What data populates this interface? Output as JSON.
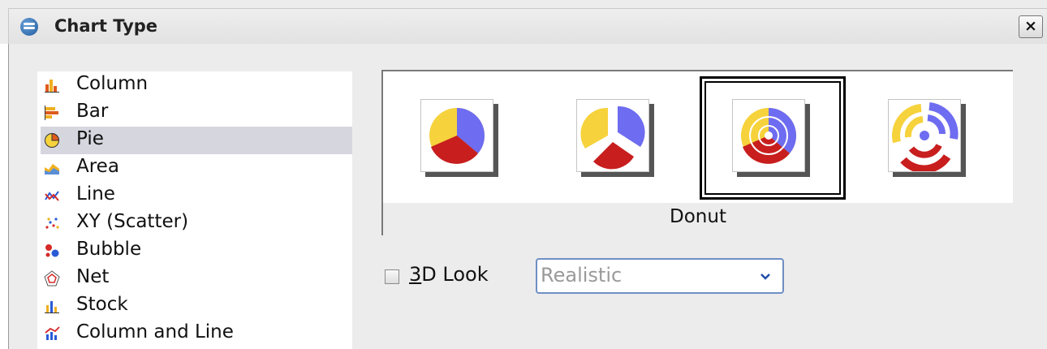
{
  "window": {
    "title": "Chart Type",
    "close_label": "×"
  },
  "chart_types": [
    {
      "label": "Column",
      "icon": "column-chart-icon"
    },
    {
      "label": "Bar",
      "icon": "bar-chart-icon"
    },
    {
      "label": "Pie",
      "icon": "pie-chart-icon",
      "selected": true
    },
    {
      "label": "Area",
      "icon": "area-chart-icon"
    },
    {
      "label": "Line",
      "icon": "line-chart-icon"
    },
    {
      "label": "XY (Scatter)",
      "icon": "scatter-chart-icon"
    },
    {
      "label": "Bubble",
      "icon": "bubble-chart-icon"
    },
    {
      "label": "Net",
      "icon": "net-chart-icon"
    },
    {
      "label": "Stock",
      "icon": "stock-chart-icon"
    },
    {
      "label": "Column and Line",
      "icon": "column-and-line-chart-icon"
    }
  ],
  "variants": {
    "selected_caption": "Donut",
    "items": [
      "normal-pie",
      "exploded-pie",
      "donut",
      "exploded-donut"
    ],
    "selected_index": 2
  },
  "options": {
    "look3d_prefix": "",
    "look3d_mnemonic": "3",
    "look3d_rest": "D Look",
    "look3d_checked": false,
    "scheme_value": "Realistic"
  },
  "colors": {
    "blue": "#6e6cf0",
    "yellow": "#f6d23c",
    "red": "#c81e1e",
    "selection": "#d6d6df"
  }
}
